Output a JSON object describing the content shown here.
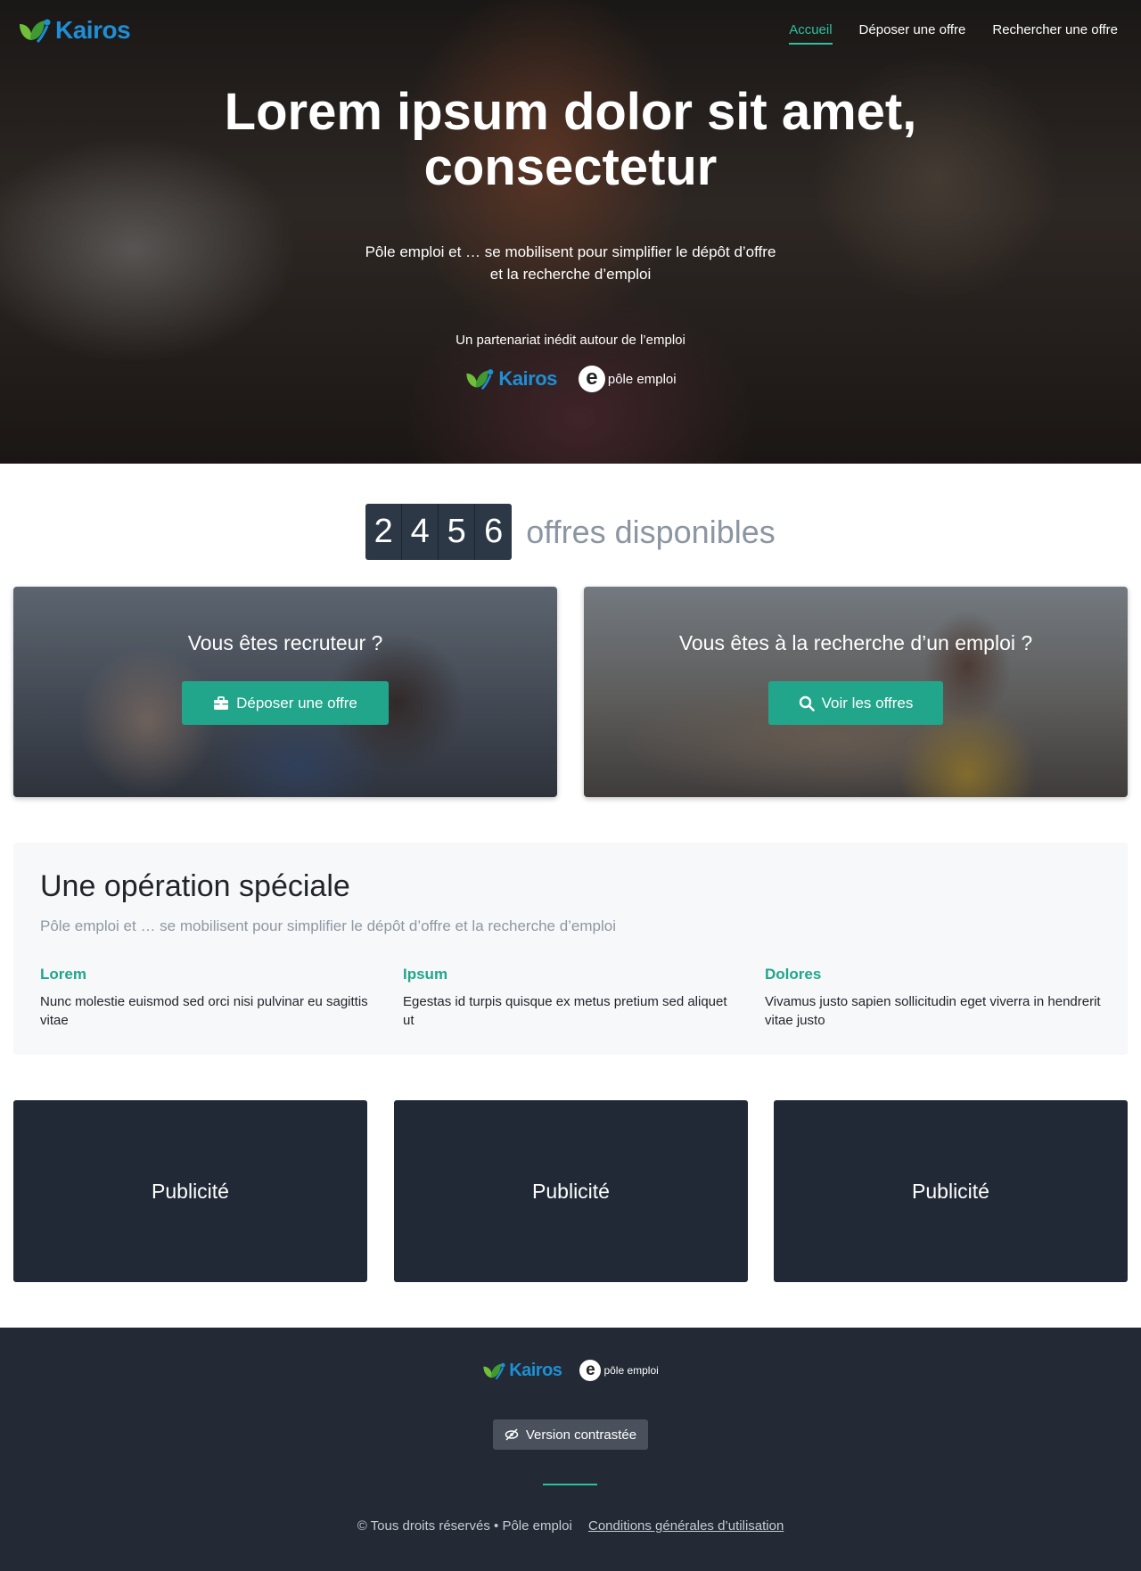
{
  "brand": {
    "name": "Kairos",
    "color": "#1e8fd6",
    "accent": "#21a68b"
  },
  "nav": {
    "items": [
      {
        "label": "Accueil",
        "active": true
      },
      {
        "label": "Déposer une offre",
        "active": false
      },
      {
        "label": "Rechercher une offre",
        "active": false
      }
    ]
  },
  "hero": {
    "title_line1": "Lorem ipsum dolor sit amet,",
    "title_line2": "consectetur",
    "subtitle_line1": "Pôle emploi et … se mobilisent pour simplifier le dépôt d’offre",
    "subtitle_line2": "et la recherche d’emploi",
    "partnership": "Un partenariat inédit autour de l’emploi",
    "partner_kairos": "Kairos",
    "partner_pe": "pôle emploi"
  },
  "counter": {
    "digits": [
      "2",
      "4",
      "5",
      "6"
    ],
    "label": "offres disponibles"
  },
  "cta": {
    "recruiter": {
      "title": "Vous êtes recruteur ?",
      "button": "Déposer une offre",
      "icon": "briefcase-icon"
    },
    "jobseeker": {
      "title": "Vous êtes à la recherche d’un emploi ?",
      "button": "Voir les offres",
      "icon": "search-icon"
    }
  },
  "special": {
    "title": "Une opération spéciale",
    "lead": "Pôle emploi et … se mobilisent pour simplifier le dépôt d’offre et la recherche d’emploi",
    "features": [
      {
        "title": "Lorem",
        "text": "Nunc molestie euismod sed orci nisi pulvinar eu sagittis vitae"
      },
      {
        "title": "Ipsum",
        "text": "Egestas id turpis quisque ex metus pretium sed aliquet ut"
      },
      {
        "title": "Dolores",
        "text": "Vivamus justo sapien sollicitudin eget viverra in hendrerit vitae justo"
      }
    ]
  },
  "ads": [
    "Publicité",
    "Publicité",
    "Publicité"
  ],
  "footer": {
    "kairos": "Kairos",
    "pe": "pôle emploi",
    "contrast_button": "Version contrastée",
    "copyright": "© Tous droits réservés • Pôle emploi",
    "terms_link": "Conditions générales d’utilisation"
  }
}
